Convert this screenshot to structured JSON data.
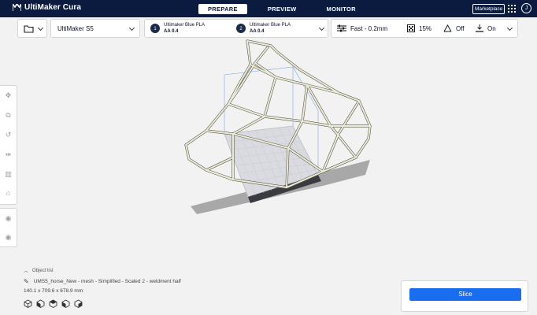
{
  "app": {
    "name": "UltiMaker Cura"
  },
  "stages": [
    {
      "label": "PREPARE",
      "active": true
    },
    {
      "label": "PREVIEW",
      "active": false
    },
    {
      "label": "MONITOR",
      "active": false
    }
  ],
  "header": {
    "marketplace_label": "Marketplace",
    "account_initial": "J"
  },
  "printer": {
    "name": "UltiMaker S5"
  },
  "extruders": [
    {
      "number": "1",
      "material": "Ultimaker Blue PLA",
      "core": "AA 0.4"
    },
    {
      "number": "2",
      "material": "Ultimaker Blue PLA",
      "core": "AA 0.4"
    }
  ],
  "print_settings": {
    "profile": "Fast - 0.2mm",
    "infill": "15%",
    "support": "Off",
    "adhesion": "On"
  },
  "left_tools": [
    "move-icon",
    "scale-icon",
    "rotate-icon",
    "mirror-icon",
    "per-model-settings-icon",
    "support-blocker-icon"
  ],
  "left_tools_extra": [
    "extruder-1-icon",
    "extruder-2-icon"
  ],
  "object_list": {
    "header": "Object list",
    "object_name": "UMS5_horse_New - mesh - Simplified - Scaled 2 - weldment half",
    "dimensions": "140.1 x 709.6 x 678.9 mm"
  },
  "view_modes": [
    "3d-view-icon",
    "front-view-icon",
    "top-view-icon",
    "left-view-icon",
    "right-view-icon"
  ],
  "slice": {
    "label": "Slice"
  },
  "colors": {
    "header_bg": "#0a1b3f",
    "accent": "#196ef0",
    "model": "#e8e6d4",
    "shadow": "#9a9a9a"
  }
}
